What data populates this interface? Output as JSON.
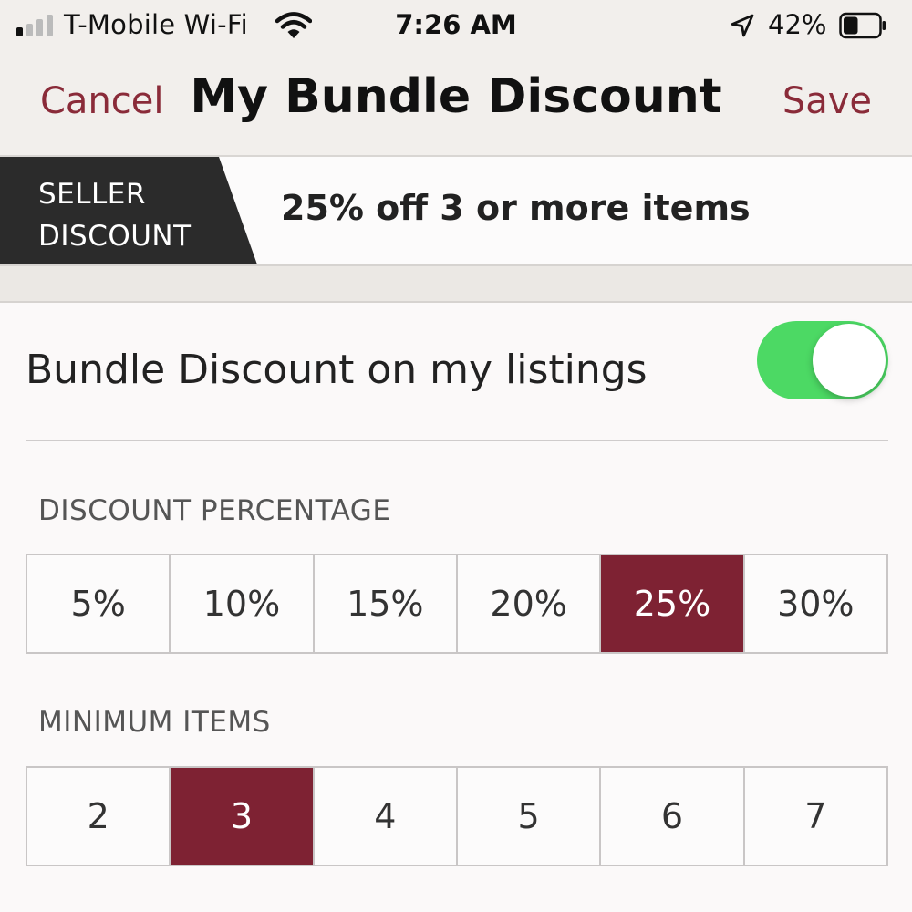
{
  "status_bar": {
    "carrier": "T-Mobile Wi-Fi",
    "time": "7:26 AM",
    "battery_percent": "42%",
    "battery_level": 0.42,
    "signal_bars_active": 1,
    "signal_bars_total": 4
  },
  "nav": {
    "cancel_label": "Cancel",
    "title": "My Bundle Discount",
    "save_label": "Save"
  },
  "banner": {
    "tag_line1": "SELLER",
    "tag_line2": "DISCOUNT",
    "summary": "25% off 3 or more items"
  },
  "toggle": {
    "label": "Bundle Discount on my listings",
    "on": true
  },
  "discount_percentage": {
    "label": "DISCOUNT PERCENTAGE",
    "options": [
      "5%",
      "10%",
      "15%",
      "20%",
      "25%",
      "30%"
    ],
    "selected_index": 4
  },
  "minimum_items": {
    "label": "MINIMUM ITEMS",
    "options": [
      "2",
      "3",
      "4",
      "5",
      "6",
      "7"
    ],
    "selected_index": 1
  },
  "colors": {
    "accent": "#8a2b39",
    "selected": "#7e2233",
    "toggle_on": "#4cd964",
    "banner_tag": "#2b2b2b"
  },
  "icons": [
    "signal-icon",
    "wifi-icon",
    "location-arrow-icon",
    "battery-icon"
  ]
}
